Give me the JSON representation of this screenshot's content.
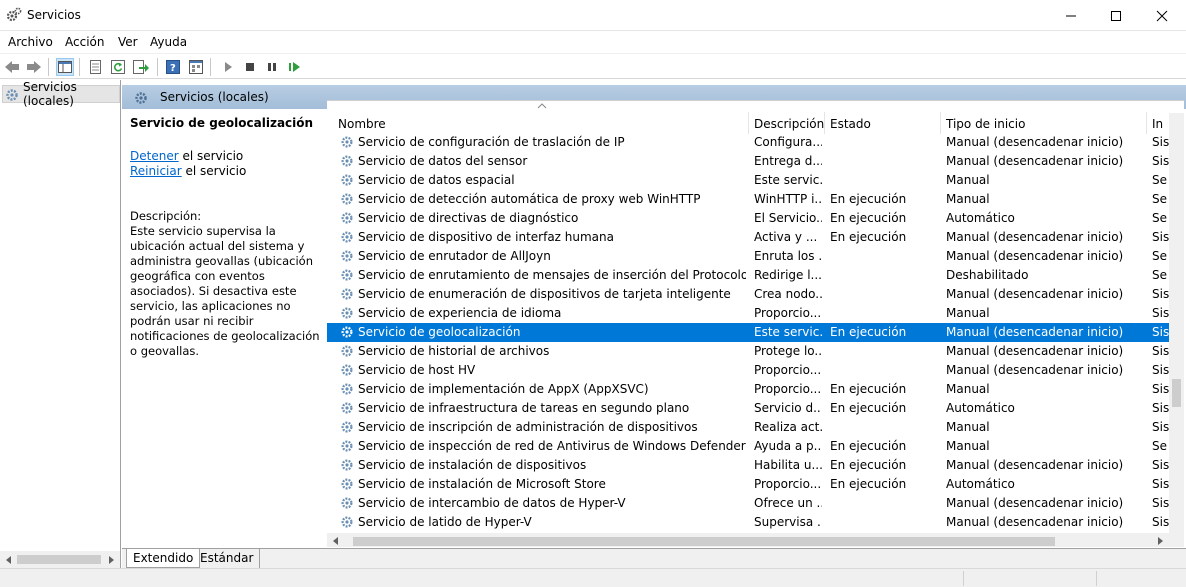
{
  "window": {
    "title": "Servicios",
    "icon": "gear-icon"
  },
  "menu": [
    "Archivo",
    "Acción",
    "Ver",
    "Ayuda"
  ],
  "tree": {
    "root_label": "Servicios (locales)"
  },
  "panel": {
    "header": "Servicios (locales)",
    "selected_title": "Servicio de geolocalización",
    "link_stop": "Detener",
    "link_stop_suffix": " el servicio",
    "link_restart": "Reiniciar",
    "link_restart_suffix": " el servicio",
    "description_label": "Descripción:",
    "description": "Este servicio supervisa la ubicación actual del sistema y administra geovallas (ubicación geográfica con eventos asociados). Si desactiva este servicio, las aplicaciones no podrán usar ni recibir notificaciones de geolocalización o geovallas."
  },
  "columns": [
    "Nombre",
    "Descripción",
    "Estado",
    "Tipo de inicio",
    "In"
  ],
  "rows": [
    {
      "name": "Servicio de configuración de traslación de IP",
      "desc": "Configura...",
      "status": "",
      "startup": "Manual (desencadenar inicio)",
      "logon": "Sis"
    },
    {
      "name": "Servicio de datos del sensor",
      "desc": "Entrega d...",
      "status": "",
      "startup": "Manual (desencadenar inicio)",
      "logon": "Sis"
    },
    {
      "name": "Servicio de datos espacial",
      "desc": "Este servic...",
      "status": "",
      "startup": "Manual",
      "logon": "Se"
    },
    {
      "name": "Servicio de detección automática de proxy web WinHTTP",
      "desc": "WinHTTP i...",
      "status": "En ejecución",
      "startup": "Manual",
      "logon": "Se"
    },
    {
      "name": "Servicio de directivas de diagnóstico",
      "desc": "El Servicio...",
      "status": "En ejecución",
      "startup": "Automático",
      "logon": "Se"
    },
    {
      "name": "Servicio de dispositivo de interfaz humana",
      "desc": "Activa y ...",
      "status": "En ejecución",
      "startup": "Manual (desencadenar inicio)",
      "logon": "Sis"
    },
    {
      "name": "Servicio de enrutador de AllJoyn",
      "desc": "Enruta los ...",
      "status": "",
      "startup": "Manual (desencadenar inicio)",
      "logon": "Se"
    },
    {
      "name": "Servicio de enrutamiento de mensajes de inserción del Protocolo de apli...",
      "desc": "Redirige l...",
      "status": "",
      "startup": "Deshabilitado",
      "logon": "Se"
    },
    {
      "name": "Servicio de enumeración de dispositivos de tarjeta inteligente",
      "desc": "Crea nodo...",
      "status": "",
      "startup": "Manual (desencadenar inicio)",
      "logon": "Sis"
    },
    {
      "name": "Servicio de experiencia de idioma",
      "desc": "Proporcio...",
      "status": "",
      "startup": "Manual",
      "logon": "Sis"
    },
    {
      "name": "Servicio de geolocalización",
      "desc": "Este servic...",
      "status": "En ejecución",
      "startup": "Manual (desencadenar inicio)",
      "logon": "Sis",
      "selected": true
    },
    {
      "name": "Servicio de historial de archivos",
      "desc": "Protege lo...",
      "status": "",
      "startup": "Manual (desencadenar inicio)",
      "logon": "Sis"
    },
    {
      "name": "Servicio de host HV",
      "desc": "Proporcio...",
      "status": "",
      "startup": "Manual (desencadenar inicio)",
      "logon": "Sis"
    },
    {
      "name": "Servicio de implementación de AppX (AppXSVC)",
      "desc": "Proporcio...",
      "status": "En ejecución",
      "startup": "Manual",
      "logon": "Sis"
    },
    {
      "name": "Servicio de infraestructura de tareas en segundo plano",
      "desc": "Servicio d...",
      "status": "En ejecución",
      "startup": "Automático",
      "logon": "Sis"
    },
    {
      "name": "Servicio de inscripción de administración de dispositivos",
      "desc": "Realiza act...",
      "status": "",
      "startup": "Manual",
      "logon": "Sis"
    },
    {
      "name": "Servicio de inspección de red de Antivirus de Windows Defender",
      "desc": "Ayuda a p...",
      "status": "En ejecución",
      "startup": "Manual",
      "logon": "Se"
    },
    {
      "name": "Servicio de instalación de dispositivos",
      "desc": "Habilita u...",
      "status": "En ejecución",
      "startup": "Manual (desencadenar inicio)",
      "logon": "Sis"
    },
    {
      "name": "Servicio de instalación de Microsoft Store",
      "desc": "Proporcio...",
      "status": "En ejecución",
      "startup": "Automático",
      "logon": "Sis"
    },
    {
      "name": "Servicio de intercambio de datos de Hyper-V",
      "desc": "Ofrece un ...",
      "status": "",
      "startup": "Manual (desencadenar inicio)",
      "logon": "Sis"
    },
    {
      "name": "Servicio de latido de Hyper-V",
      "desc": "Supervisa ...",
      "status": "",
      "startup": "Manual (desencadenar inicio)",
      "logon": "Sis"
    }
  ],
  "tabs": [
    "Extendido",
    "Estándar"
  ],
  "colors": {
    "selection": "#0078d7",
    "link": "#0066cc",
    "header_band": "#a3bdd8"
  }
}
